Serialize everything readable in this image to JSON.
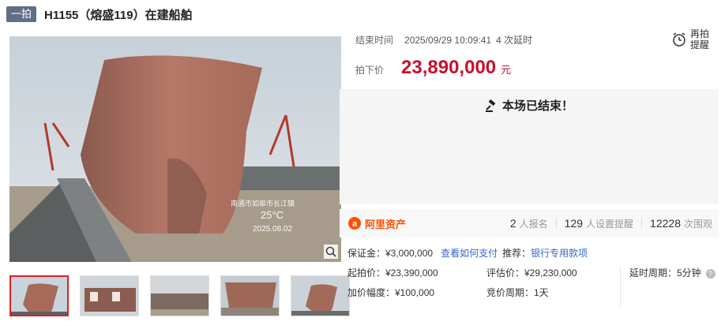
{
  "header": {
    "badge": "一拍",
    "title": "H1155（熔盛119）在建船舶"
  },
  "image": {
    "overlay_location": "南通市如皋市长江镇",
    "overlay_temp": "25°C",
    "overlay_date": "2025.08.02"
  },
  "auction": {
    "end_label": "结束时间",
    "end_time": "2025/09/29 10:09:41",
    "delays": "4 次延时",
    "price_label": "拍下价",
    "price": "23,890,000",
    "price_unit": "元",
    "remind_label": "再拍提醒",
    "ended_text": "本场已结束！"
  },
  "stats": {
    "brand": "阿里资产",
    "signups_value": "2",
    "signups_label": "人报名",
    "reminders_value": "129",
    "reminders_label": "人设置提醒",
    "views_value": "12228",
    "views_label": "次围观"
  },
  "details": {
    "deposit": "保证金：¥3,000,000",
    "how_to_pay": "查看如何支付",
    "recommend": "推荐：",
    "bank_account": "银行专用款项",
    "start_price": "起拍价：¥23,390,000",
    "appraisal": "评估价：¥29,230,000",
    "delay_period": "延时周期：5分钟",
    "increment": "加价幅度：¥100,000",
    "bid_period": "竞价周期：1天"
  },
  "colors": {
    "price": "#c8102e",
    "link": "#3366cc",
    "badge": "#5f6f86",
    "brand": "#ff5000"
  }
}
